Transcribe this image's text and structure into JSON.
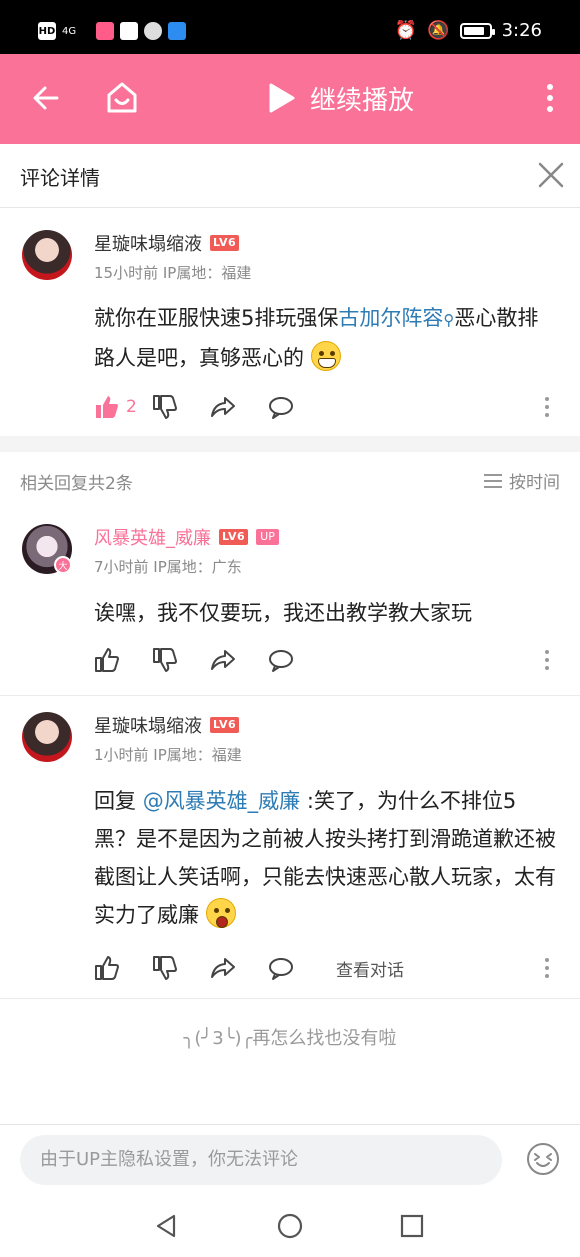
{
  "status_bar": {
    "network": "4G",
    "time": "3:26",
    "battery_level": 0.85
  },
  "top_bar": {
    "play_label": "继续播放"
  },
  "panel": {
    "title": "评论详情"
  },
  "main_comment": {
    "username": "星璇味塌缩液",
    "level": "LV6",
    "meta": "15小时前 IP属地：福建",
    "text_before": "就你在亚服快速5排玩强保",
    "link_text": "古加尔阵容",
    "text_after": "恶心散排路人是吧，真够恶心的",
    "like_count": "2"
  },
  "replies_header": {
    "count_label": "相关回复共2条",
    "sort_label": "按时间"
  },
  "replies": [
    {
      "username": "风暴英雄_威廉",
      "level": "LV6",
      "up_badge": "UP",
      "avatar_badge": "大",
      "meta": "7小时前 IP属地：广东",
      "text": "诶嘿，我不仅要玩，我还出教学教大家玩"
    },
    {
      "username": "星璇味塌缩液",
      "level": "LV6",
      "meta": "1小时前 IP属地：福建",
      "reply_prefix": "回复 ",
      "mention": "@风暴英雄_威廉",
      "text": " :笑了，为什么不排位5黑？是不是因为之前被人按头拷打到滑跪道歉还被截图让人笑话啊，只能去快速恶心散人玩家，太有实力了威廉",
      "dialog_label": "查看对话"
    }
  ],
  "end_text": "╮(╯3╰)╭再怎么找也没有啦",
  "comment_input": {
    "placeholder": "由于UP主隐私设置，你无法评论"
  },
  "colors": {
    "brand_pink": "#fb7299",
    "link_blue": "#2e7cb5",
    "level_red": "#f05b56"
  },
  "icons": [
    "back-icon",
    "home-icon",
    "play-icon",
    "more-icon",
    "close-icon",
    "like-icon",
    "dislike-icon",
    "share-icon",
    "reply-icon",
    "sort-icon",
    "emoji-icon"
  ]
}
